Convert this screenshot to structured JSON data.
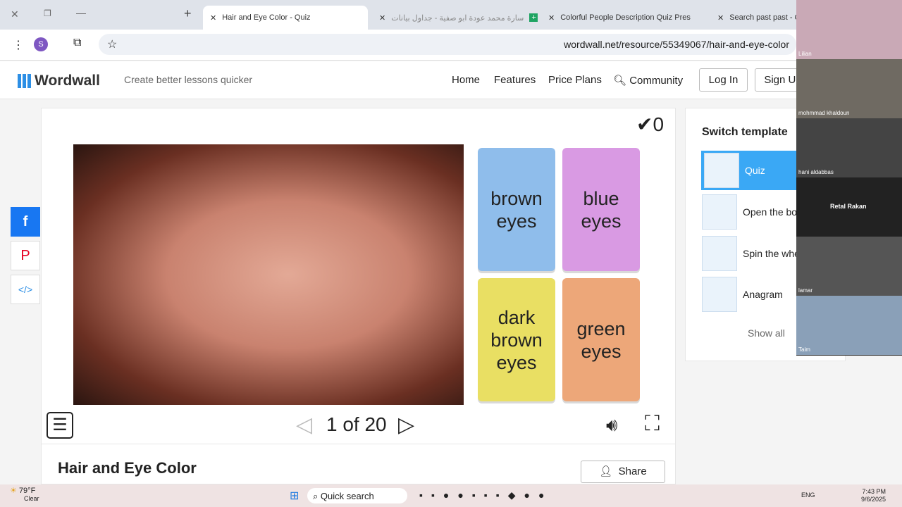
{
  "browser": {
    "tabs": [
      {
        "label": "Hair and Eye Color - Quiz",
        "active": true
      },
      {
        "label": "سارة محمد عودة ابو صفية - جداول بيانات"
      },
      {
        "label": "Colorful People Description Quiz Pres"
      },
      {
        "label": "Search past past - Ca"
      }
    ],
    "url": "wordwall.net/resource/55349067/hair-and-eye-color",
    "profile": "S"
  },
  "site": {
    "logo": "Wordwall",
    "tagline": "Create better lessons quicker",
    "nav": [
      "Home",
      "Features",
      "Price Plans",
      "Community"
    ],
    "login": "Log In",
    "signup": "Sign Up"
  },
  "quiz": {
    "score": "0",
    "answers": [
      {
        "label": "brown eyes",
        "color": "#8fbdeb"
      },
      {
        "label": "blue eyes",
        "color": "#d99ae3"
      },
      {
        "label": "dark brown eyes",
        "color": "#e9df63"
      },
      {
        "label": "green eyes",
        "color": "#eda779"
      }
    ],
    "progress": "1 of 20",
    "title": "Hair and Eye Color",
    "share": "Share"
  },
  "sidebar": {
    "title": "Switch template",
    "templates": [
      "Quiz",
      "Open the box",
      "Spin the wheel",
      "Anagram"
    ],
    "show_all": "Show all",
    "accent": "#3aa8f5"
  },
  "participants": [
    "Lilian",
    "mohmmad khaldoun",
    "hani aldabbas",
    "Retal Rakan",
    "lamar",
    "Taim"
  ],
  "taskbar": {
    "weather": "79°F",
    "weather_desc": "Clear",
    "search": "Quick search",
    "lang": "ENG",
    "time": "7:43 PM",
    "date": "9/6/2025"
  }
}
